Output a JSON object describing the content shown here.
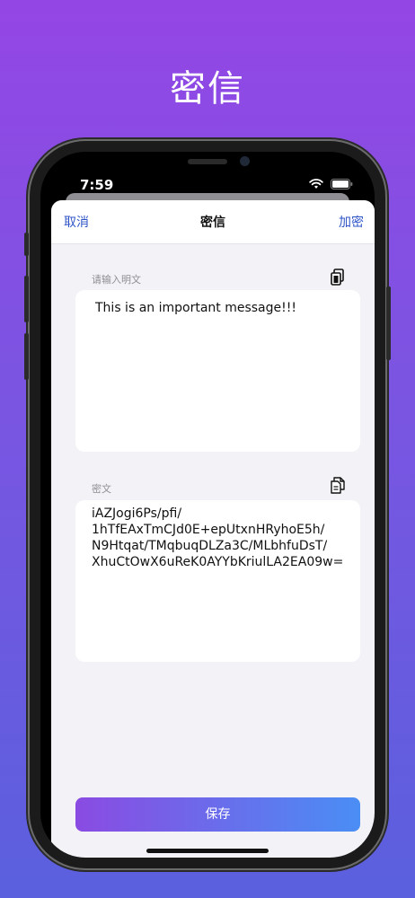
{
  "app_title": "密信",
  "status_bar": {
    "time": "7:59"
  },
  "nav": {
    "cancel": "取消",
    "title": "密信",
    "encrypt": "加密"
  },
  "plaintext": {
    "label": "请输入明文",
    "value": "This is an important message!!!"
  },
  "ciphertext": {
    "label": "密文",
    "value": "iAZJogi6Ps/pfi/\n1hTfEAxTmCJd0E+epUtxnHRyhoE5h/\nN9Htqat/TMqbuqDLZa3C/MLbhfuDsT/\nXhuCtOwX6uReK0AYYbKriulLA2EA09w="
  },
  "save_button": "保存"
}
